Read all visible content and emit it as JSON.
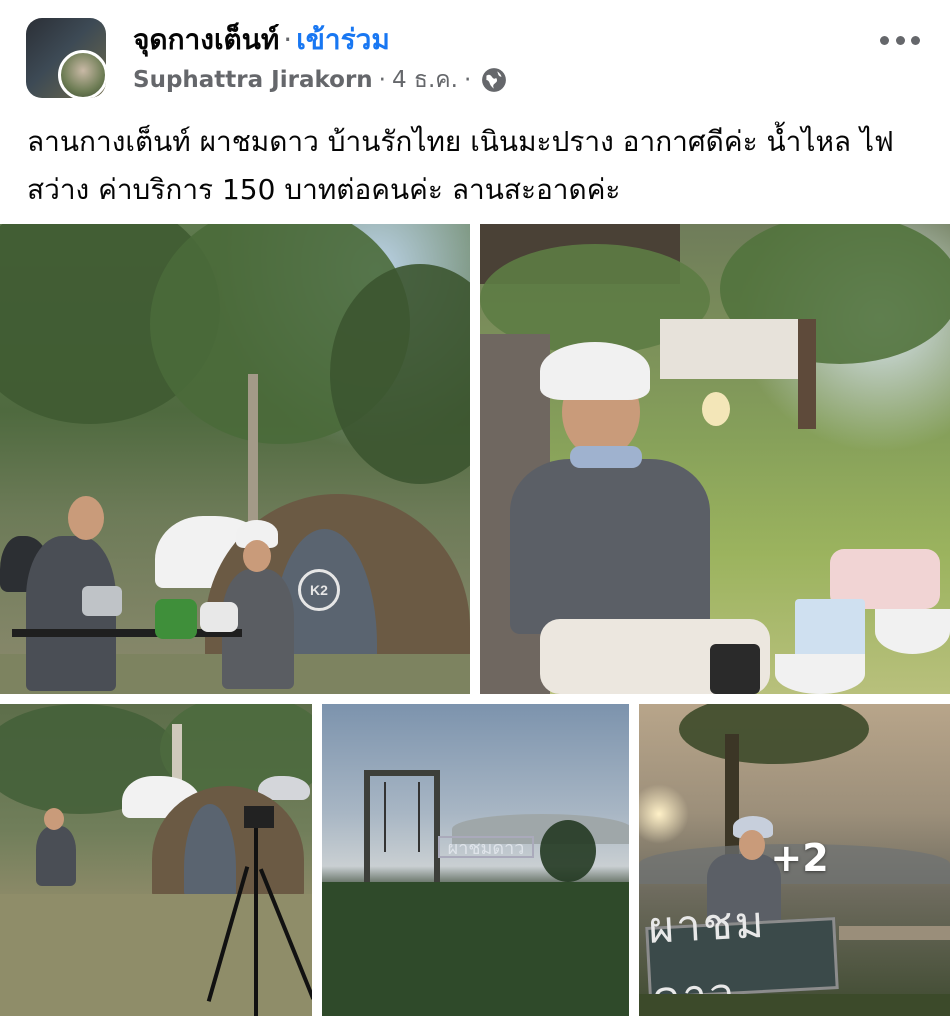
{
  "post": {
    "group_name": "จุดกางเต็นท์",
    "dot": "·",
    "join_label": "เข้าร่วม",
    "author": "Suphattra Jirakorn",
    "date": "4 ธ.ค.",
    "audience_icon": "globe-icon",
    "more_icon": "more-icon",
    "text": "ลานกางเต็นท์ ผาชมดาว บ้านรักไทย เนินมะปราง อากาศดีค่ะ น้ำไหล ไฟสว่าง ค่าบริการ 150 บาทต่อคนค่ะ ลานสะอาดค่ะ"
  },
  "photos": {
    "tent_badge": "K2",
    "sign_text": "ผาชมดาว",
    "more_count": "+2"
  },
  "colors": {
    "join": "#1877f2",
    "secondary_text": "#65676b"
  }
}
